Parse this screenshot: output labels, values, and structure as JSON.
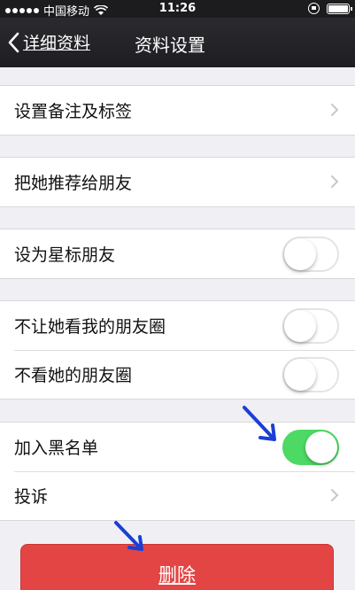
{
  "status_bar": {
    "carrier": "中国移动",
    "time": "11:26"
  },
  "nav": {
    "back_label": "详细资料",
    "title": "资料设置"
  },
  "groups": [
    {
      "rows": [
        {
          "label": "设置备注及标签",
          "control": "chevron"
        }
      ]
    },
    {
      "rows": [
        {
          "label": "把她推荐给朋友",
          "control": "chevron"
        }
      ]
    },
    {
      "rows": [
        {
          "label": "设为星标朋友",
          "control": "toggle",
          "on": false
        }
      ]
    },
    {
      "rows": [
        {
          "label": "不让她看我的朋友圈",
          "control": "toggle",
          "on": false
        },
        {
          "label": "不看她的朋友圈",
          "control": "toggle",
          "on": false
        }
      ]
    },
    {
      "rows": [
        {
          "label": "加入黑名单",
          "control": "toggle",
          "on": true
        },
        {
          "label": "投诉",
          "control": "chevron"
        }
      ]
    }
  ],
  "delete_button": {
    "label": "删除"
  },
  "colors": {
    "toggle_on": "#4cd964",
    "delete": "#e34545",
    "annotation_arrow": "#1a3fd6"
  }
}
